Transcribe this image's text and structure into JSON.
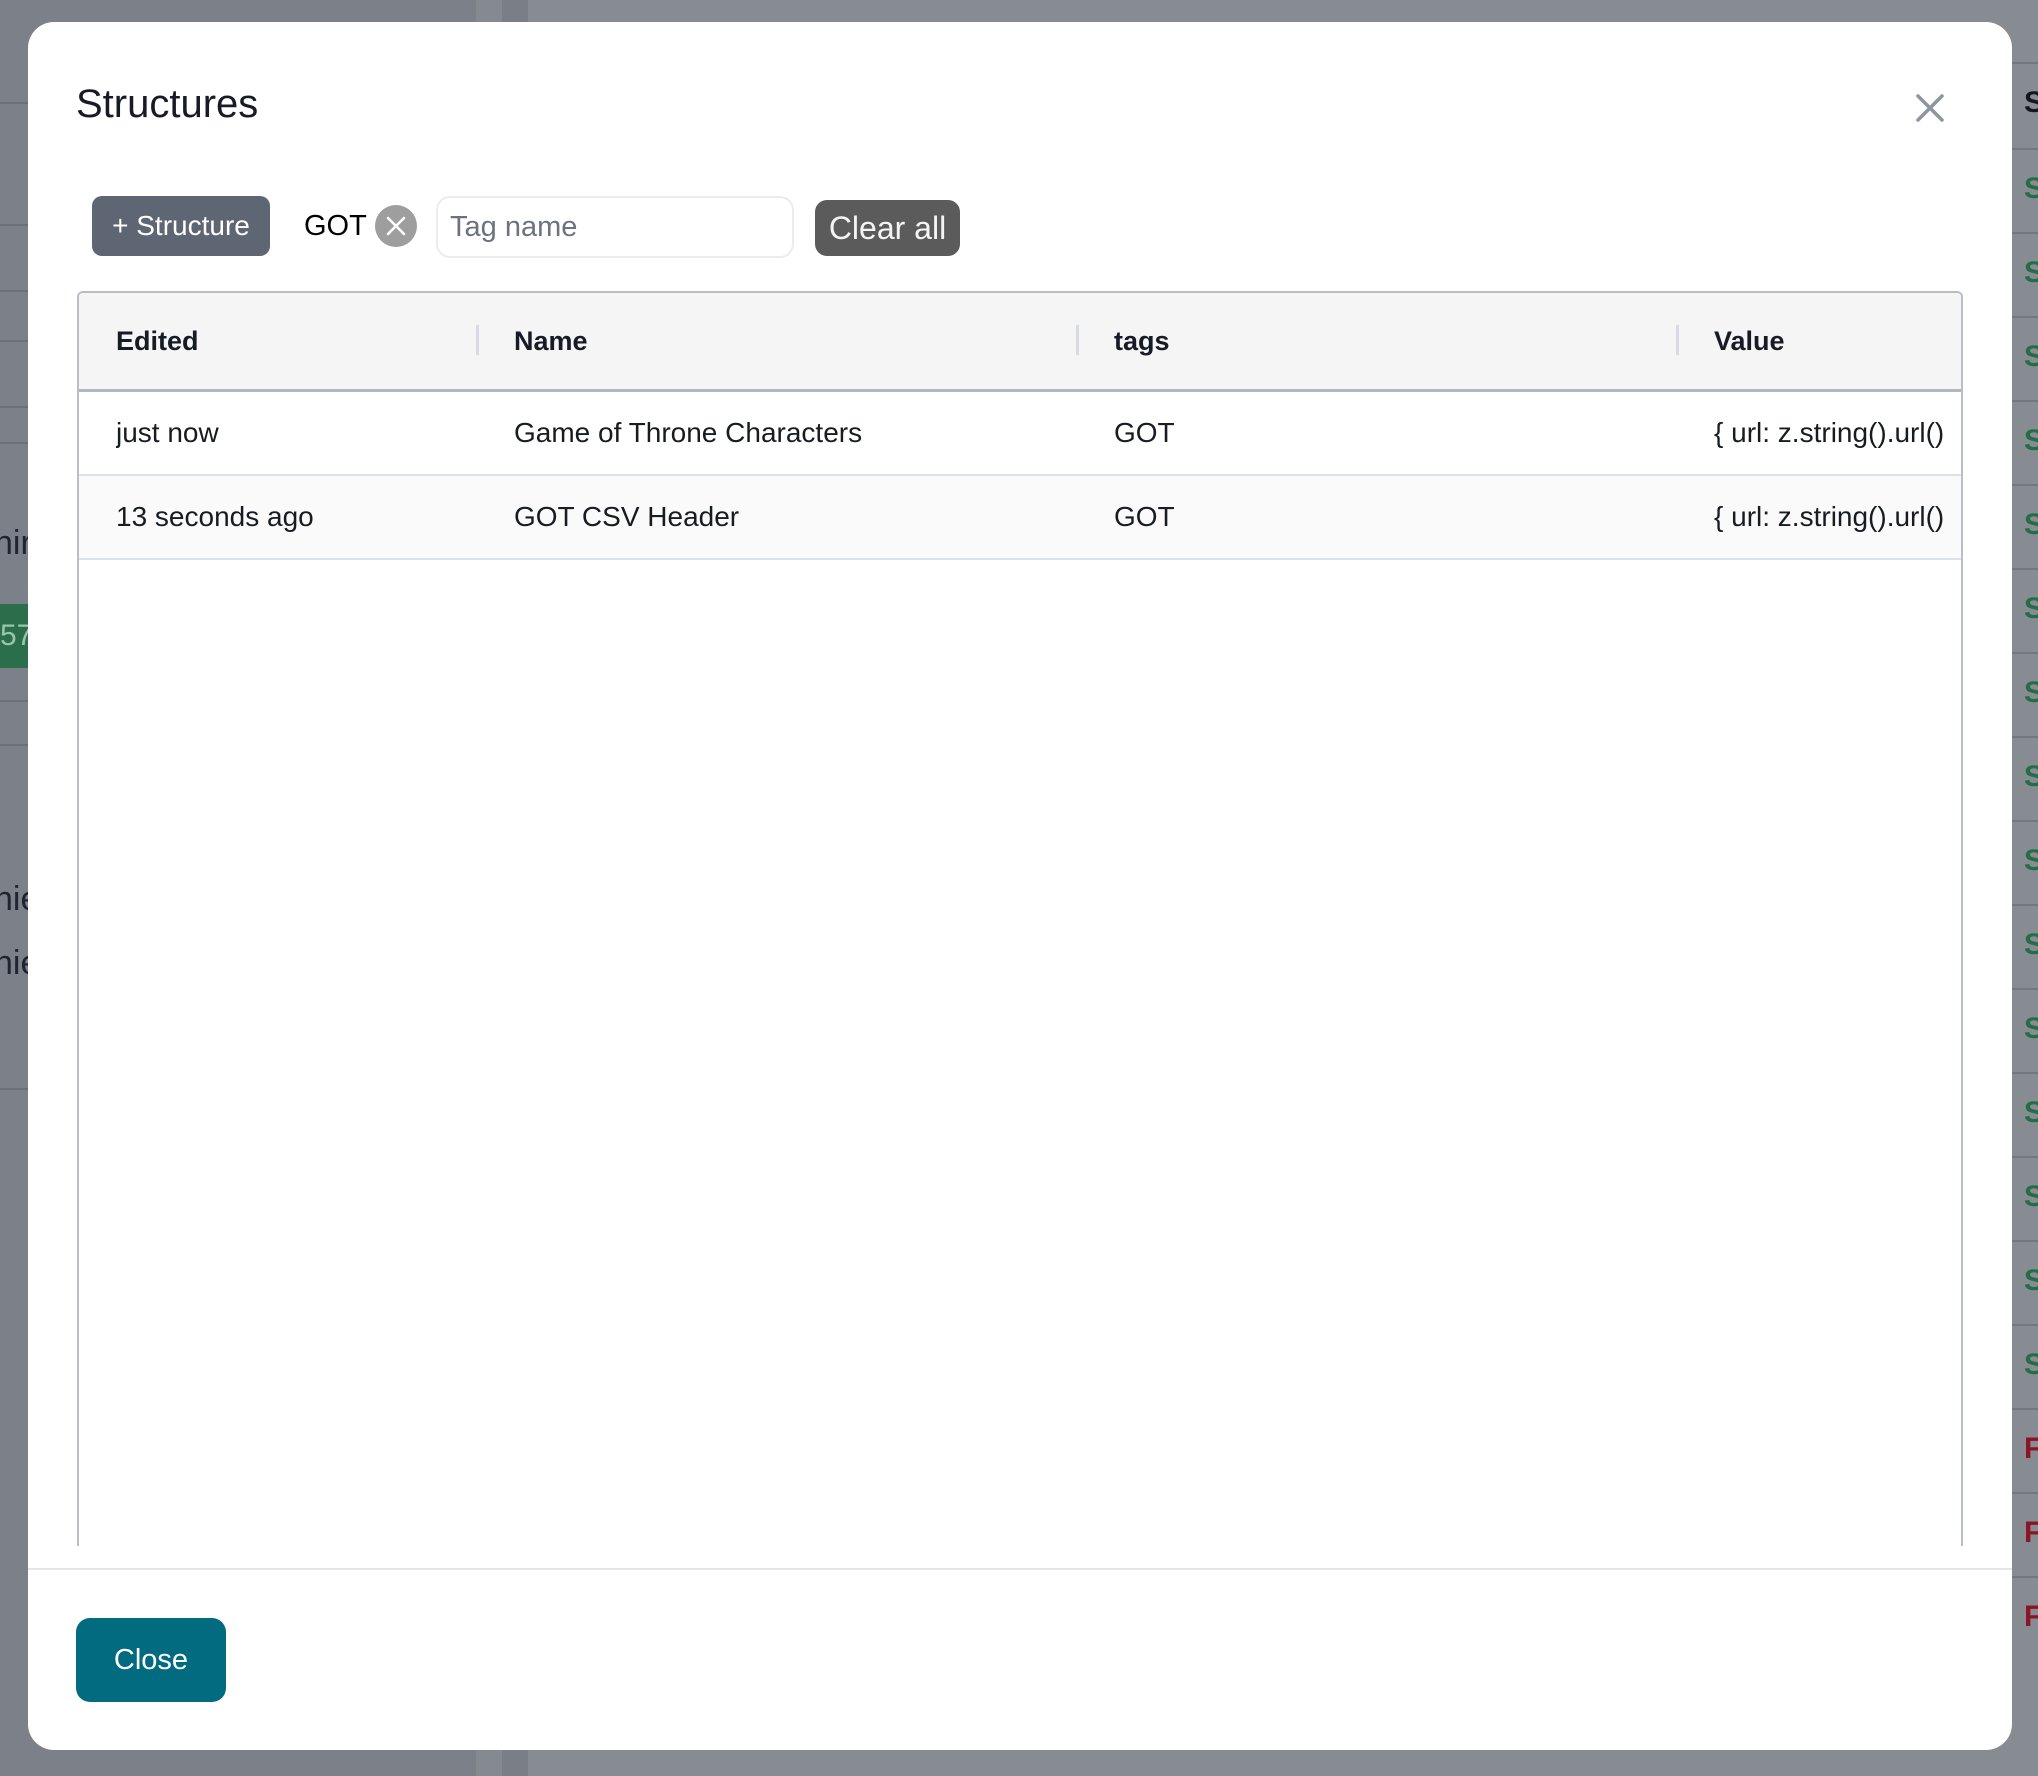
{
  "background": {
    "left_fragments": [
      "hir",
      "57",
      "hie",
      "hie"
    ],
    "right_column": {
      "header_fragment": "S",
      "status_fragments": [
        "S",
        "S",
        "S",
        "S",
        "S",
        "S",
        "S",
        "S",
        "S",
        "S",
        "S",
        "S",
        "S",
        "S",
        "S",
        "F",
        "F",
        "F"
      ]
    }
  },
  "modal": {
    "title": "Structures",
    "close_icon": "close-icon",
    "toolbar": {
      "add_structure_label": "+ Structure",
      "active_tag": "GOT",
      "tag_remove_icon": "x-circle-icon",
      "tag_input_value": "",
      "tag_input_placeholder": "Tag name",
      "clear_all_label": "Clear all"
    },
    "table": {
      "columns": [
        "Edited",
        "Name",
        "tags",
        "Value"
      ],
      "rows": [
        {
          "edited": "just now",
          "name": "Game of Throne Characters",
          "tags": "GOT",
          "value": "{ url: z.string().url()"
        },
        {
          "edited": "13 seconds ago",
          "name": "GOT CSV Header",
          "tags": "GOT",
          "value": "{ url: z.string().url()"
        }
      ]
    },
    "footer": {
      "close_label": "Close"
    }
  },
  "colors": {
    "primary_button": "#036b80",
    "secondary_button": "#5f6673",
    "clear_all_button": "#5b5b5b",
    "success_text": "#236e46",
    "failure_text": "#8a1526"
  }
}
